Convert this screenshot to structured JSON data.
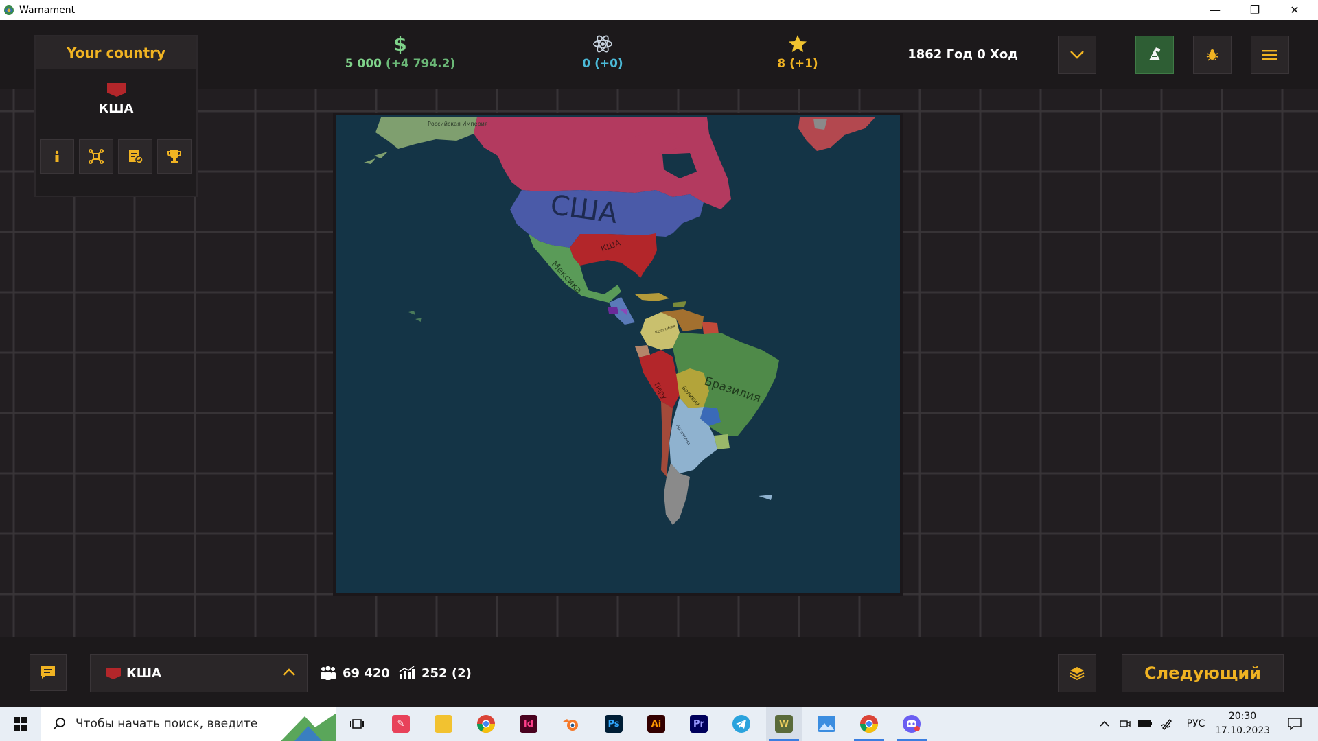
{
  "window": {
    "title": "Warnament"
  },
  "country_panel": {
    "header": "Your country",
    "country": "КША",
    "flag_color": "#b3262a"
  },
  "resources": {
    "money": {
      "value": "5 000",
      "delta": "(+4 794.2)",
      "color": "#7fd28a"
    },
    "science": {
      "value": "0",
      "delta": "(+0)",
      "color": "#4bbad8"
    },
    "prestige": {
      "value": "8",
      "delta": "(+1)",
      "color": "#f0b322"
    }
  },
  "turn": {
    "label": "1862 Год 0 Ход"
  },
  "map": {
    "labels": {
      "russian_empire": "Российская Империя",
      "usa": "США",
      "csa": "КША",
      "mexico": "Мексика",
      "colombia": "Колумбия",
      "brazil": "Бразилия",
      "peru": "Перу",
      "bolivia": "Боливия",
      "argentina": "Аргентина"
    }
  },
  "bottom": {
    "selected_country": "КША",
    "population": "69 420",
    "industry": "252 (2)",
    "next_button": "Следующий"
  },
  "taskbar": {
    "search_placeholder": "Чтобы начать поиск, введите",
    "language": "РУС",
    "time": "20:30",
    "date": "17.10.2023"
  },
  "colors": {
    "accent": "#f0b322",
    "ocean": "#143446",
    "usa": "#4a5aa8",
    "csa": "#b3262a",
    "canada": "#b33a5f",
    "mexico": "#5a9b58",
    "brazil": "#4f8a49",
    "argentina": "#8fb2cf"
  }
}
